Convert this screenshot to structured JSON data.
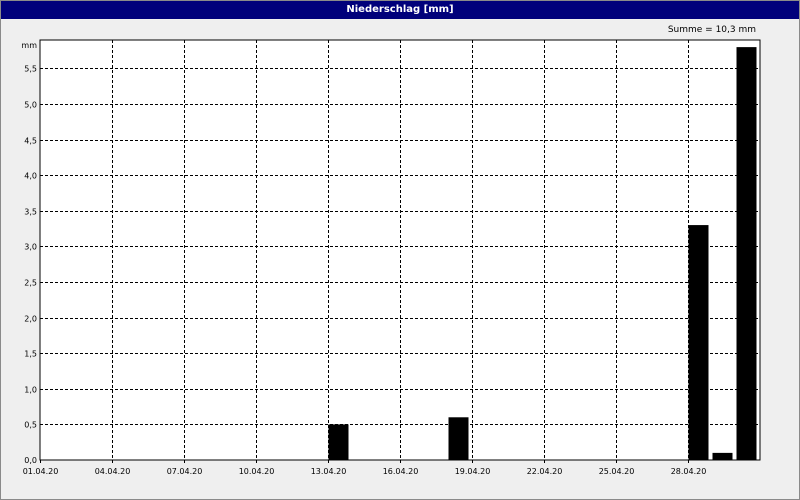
{
  "window": {
    "title": "Niederschlag [mm]"
  },
  "summary": "Summe = 10,3 mm",
  "chart_data": {
    "type": "bar",
    "title": "Niederschlag [mm]",
    "ylabel": "mm",
    "ylim": [
      0,
      5.9
    ],
    "yticks": [
      0.5,
      1.0,
      1.5,
      2.0,
      2.5,
      3.0,
      3.5,
      4.0,
      4.5,
      5.0,
      5.5
    ],
    "ytick_labels": [
      "0,5",
      "1,0",
      "1,5",
      "2,0",
      "2,5",
      "3,0",
      "3,5",
      "4,0",
      "4,5",
      "5,0",
      "5,5"
    ],
    "xlim": [
      "01.04.20",
      "01.05.20"
    ],
    "xticks": [
      "01.04.20",
      "04.04.20",
      "07.04.20",
      "10.04.20",
      "13.04.20",
      "16.04.20",
      "19.04.20",
      "22.04.20",
      "25.04.20",
      "28.04.20"
    ],
    "grid": true,
    "series": [
      {
        "dates": [
          "13.04.20",
          "18.04.20",
          "28.04.20",
          "29.04.20",
          "30.04.20"
        ],
        "values": [
          0.5,
          0.6,
          3.3,
          0.1,
          5.8
        ]
      }
    ]
  }
}
